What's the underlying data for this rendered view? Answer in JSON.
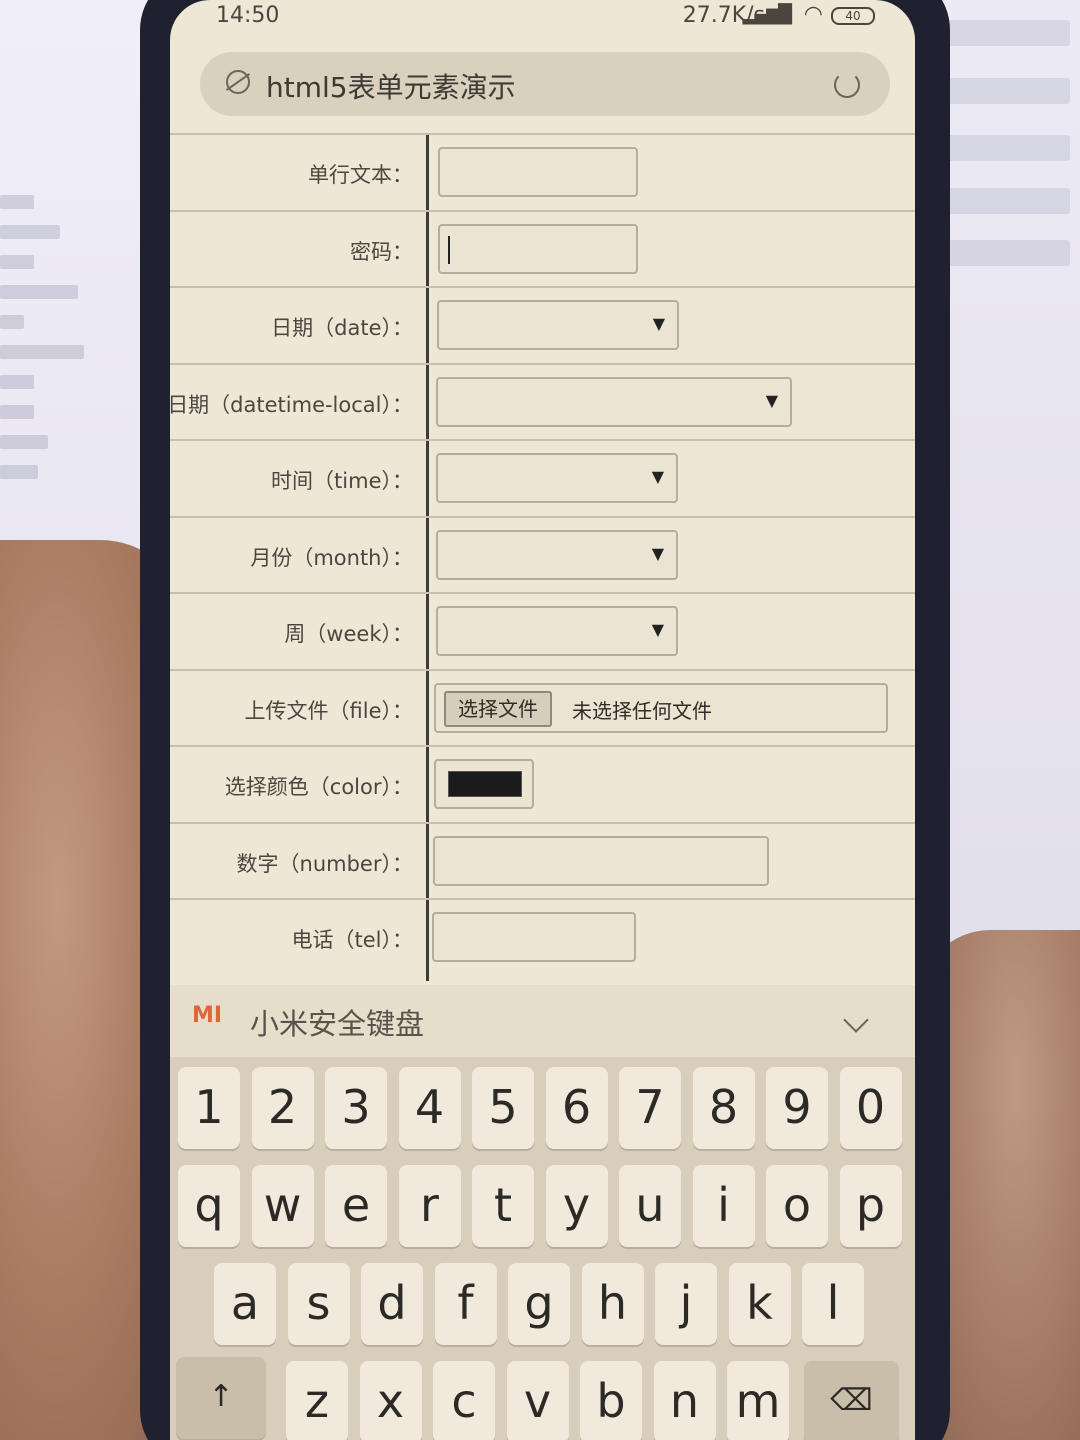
{
  "status_bar": {
    "time": "14:50",
    "net_speed": "27.7K/s",
    "signal": "HD",
    "battery": "40"
  },
  "address_bar": {
    "title": "html5表单元素演示"
  },
  "form": {
    "rows": [
      {
        "label": "单行文本："
      },
      {
        "label": "密码："
      },
      {
        "label": "日期（date）："
      },
      {
        "label": "日期（datetime-local）："
      },
      {
        "label": "时间（time）："
      },
      {
        "label": "月份（month）："
      },
      {
        "label": "周（week）："
      },
      {
        "label": "上传文件（file）："
      },
      {
        "label": "选择颜色（color）："
      },
      {
        "label": "数字（number）："
      },
      {
        "label": "电话（tel）："
      }
    ],
    "dropdown_arrow": "▼",
    "file_button": "选择文件",
    "file_status": "未选择任何文件",
    "color_value": "#1b1b1b"
  },
  "keyboard": {
    "brand": "MI",
    "name": "小米安全键盘",
    "row1": [
      "1",
      "2",
      "3",
      "4",
      "5",
      "6",
      "7",
      "8",
      "9",
      "0"
    ],
    "row2": [
      "q",
      "w",
      "e",
      "r",
      "t",
      "y",
      "u",
      "i",
      "o",
      "p"
    ],
    "row3": [
      "a",
      "s",
      "d",
      "f",
      "g",
      "h",
      "j",
      "k",
      "l"
    ],
    "row4": [
      "z",
      "x",
      "c",
      "v",
      "b",
      "n",
      "m"
    ],
    "shift": "↑",
    "backspace": "⌫"
  }
}
